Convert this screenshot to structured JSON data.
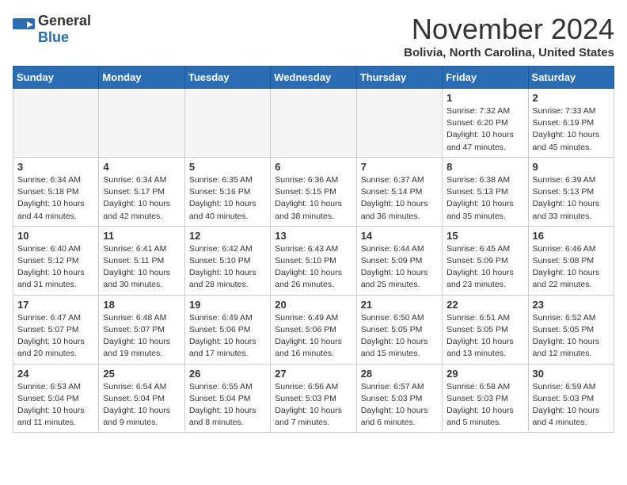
{
  "logo": {
    "general": "General",
    "blue": "Blue"
  },
  "header": {
    "month": "November 2024",
    "location": "Bolivia, North Carolina, United States"
  },
  "weekdays": [
    "Sunday",
    "Monday",
    "Tuesday",
    "Wednesday",
    "Thursday",
    "Friday",
    "Saturday"
  ],
  "weeks": [
    [
      {
        "day": "",
        "info": ""
      },
      {
        "day": "",
        "info": ""
      },
      {
        "day": "",
        "info": ""
      },
      {
        "day": "",
        "info": ""
      },
      {
        "day": "",
        "info": ""
      },
      {
        "day": "1",
        "info": "Sunrise: 7:32 AM\nSunset: 6:20 PM\nDaylight: 10 hours and 47 minutes."
      },
      {
        "day": "2",
        "info": "Sunrise: 7:33 AM\nSunset: 6:19 PM\nDaylight: 10 hours and 45 minutes."
      }
    ],
    [
      {
        "day": "3",
        "info": "Sunrise: 6:34 AM\nSunset: 5:18 PM\nDaylight: 10 hours and 44 minutes."
      },
      {
        "day": "4",
        "info": "Sunrise: 6:34 AM\nSunset: 5:17 PM\nDaylight: 10 hours and 42 minutes."
      },
      {
        "day": "5",
        "info": "Sunrise: 6:35 AM\nSunset: 5:16 PM\nDaylight: 10 hours and 40 minutes."
      },
      {
        "day": "6",
        "info": "Sunrise: 6:36 AM\nSunset: 5:15 PM\nDaylight: 10 hours and 38 minutes."
      },
      {
        "day": "7",
        "info": "Sunrise: 6:37 AM\nSunset: 5:14 PM\nDaylight: 10 hours and 36 minutes."
      },
      {
        "day": "8",
        "info": "Sunrise: 6:38 AM\nSunset: 5:13 PM\nDaylight: 10 hours and 35 minutes."
      },
      {
        "day": "9",
        "info": "Sunrise: 6:39 AM\nSunset: 5:13 PM\nDaylight: 10 hours and 33 minutes."
      }
    ],
    [
      {
        "day": "10",
        "info": "Sunrise: 6:40 AM\nSunset: 5:12 PM\nDaylight: 10 hours and 31 minutes."
      },
      {
        "day": "11",
        "info": "Sunrise: 6:41 AM\nSunset: 5:11 PM\nDaylight: 10 hours and 30 minutes."
      },
      {
        "day": "12",
        "info": "Sunrise: 6:42 AM\nSunset: 5:10 PM\nDaylight: 10 hours and 28 minutes."
      },
      {
        "day": "13",
        "info": "Sunrise: 6:43 AM\nSunset: 5:10 PM\nDaylight: 10 hours and 26 minutes."
      },
      {
        "day": "14",
        "info": "Sunrise: 6:44 AM\nSunset: 5:09 PM\nDaylight: 10 hours and 25 minutes."
      },
      {
        "day": "15",
        "info": "Sunrise: 6:45 AM\nSunset: 5:09 PM\nDaylight: 10 hours and 23 minutes."
      },
      {
        "day": "16",
        "info": "Sunrise: 6:46 AM\nSunset: 5:08 PM\nDaylight: 10 hours and 22 minutes."
      }
    ],
    [
      {
        "day": "17",
        "info": "Sunrise: 6:47 AM\nSunset: 5:07 PM\nDaylight: 10 hours and 20 minutes."
      },
      {
        "day": "18",
        "info": "Sunrise: 6:48 AM\nSunset: 5:07 PM\nDaylight: 10 hours and 19 minutes."
      },
      {
        "day": "19",
        "info": "Sunrise: 6:49 AM\nSunset: 5:06 PM\nDaylight: 10 hours and 17 minutes."
      },
      {
        "day": "20",
        "info": "Sunrise: 6:49 AM\nSunset: 5:06 PM\nDaylight: 10 hours and 16 minutes."
      },
      {
        "day": "21",
        "info": "Sunrise: 6:50 AM\nSunset: 5:05 PM\nDaylight: 10 hours and 15 minutes."
      },
      {
        "day": "22",
        "info": "Sunrise: 6:51 AM\nSunset: 5:05 PM\nDaylight: 10 hours and 13 minutes."
      },
      {
        "day": "23",
        "info": "Sunrise: 6:52 AM\nSunset: 5:05 PM\nDaylight: 10 hours and 12 minutes."
      }
    ],
    [
      {
        "day": "24",
        "info": "Sunrise: 6:53 AM\nSunset: 5:04 PM\nDaylight: 10 hours and 11 minutes."
      },
      {
        "day": "25",
        "info": "Sunrise: 6:54 AM\nSunset: 5:04 PM\nDaylight: 10 hours and 9 minutes."
      },
      {
        "day": "26",
        "info": "Sunrise: 6:55 AM\nSunset: 5:04 PM\nDaylight: 10 hours and 8 minutes."
      },
      {
        "day": "27",
        "info": "Sunrise: 6:56 AM\nSunset: 5:03 PM\nDaylight: 10 hours and 7 minutes."
      },
      {
        "day": "28",
        "info": "Sunrise: 6:57 AM\nSunset: 5:03 PM\nDaylight: 10 hours and 6 minutes."
      },
      {
        "day": "29",
        "info": "Sunrise: 6:58 AM\nSunset: 5:03 PM\nDaylight: 10 hours and 5 minutes."
      },
      {
        "day": "30",
        "info": "Sunrise: 6:59 AM\nSunset: 5:03 PM\nDaylight: 10 hours and 4 minutes."
      }
    ]
  ]
}
